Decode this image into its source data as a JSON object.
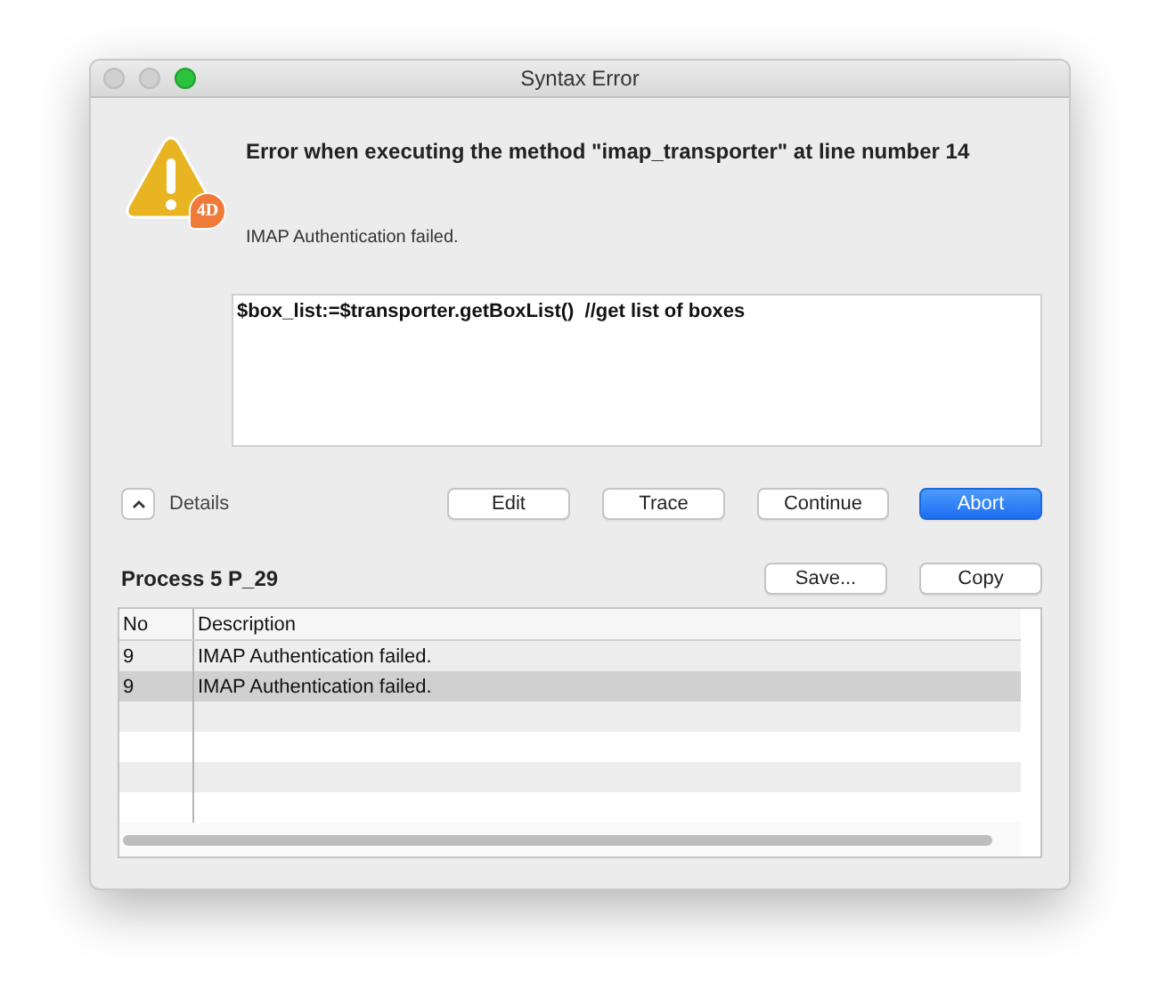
{
  "window": {
    "title": "Syntax Error"
  },
  "alert": {
    "badge": "4D",
    "heading": "Error when executing the method \"imap_transporter\" at line number 14",
    "message": "IMAP Authentication failed.",
    "code": "$box_list:=$transporter.getBoxList()  //get list of boxes"
  },
  "details": {
    "label": "Details",
    "expanded": true
  },
  "buttons": [
    {
      "label": "Edit",
      "default": false
    },
    {
      "label": "Trace",
      "default": false
    },
    {
      "label": "Continue",
      "default": false
    },
    {
      "label": "Abort",
      "default": true
    }
  ],
  "process": {
    "label": "Process 5 P_29",
    "buttons": [
      "Save...",
      "Copy"
    ]
  },
  "table": {
    "columns": [
      "No",
      "Description"
    ],
    "rows": [
      {
        "no": "9",
        "description": "IMAP Authentication failed.",
        "selected": false
      },
      {
        "no": "9",
        "description": "IMAP Authentication failed.",
        "selected": true
      }
    ]
  }
}
